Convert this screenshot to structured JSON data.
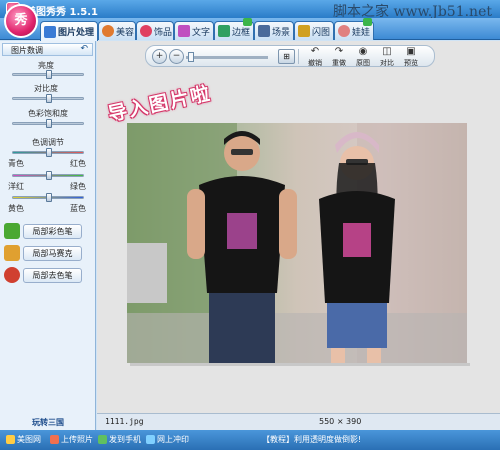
{
  "window": {
    "title": "美图秀秀 1.5.1",
    "watermark": "脚本之家 www.Jb51.net",
    "logo_text": "秀"
  },
  "tabs": [
    {
      "label": "图片处理",
      "icon": "image-edit-icon",
      "color": "#3a7bd5",
      "active": true
    },
    {
      "label": "美容",
      "icon": "face-icon",
      "color": "#e07a30",
      "active": false
    },
    {
      "label": "饰品",
      "icon": "heart-icon",
      "color": "#e04060",
      "active": false
    },
    {
      "label": "文字",
      "icon": "text-icon",
      "color": "#c050c0",
      "active": false
    },
    {
      "label": "边框",
      "icon": "frame-icon",
      "color": "#30a060",
      "active": false,
      "new": true
    },
    {
      "label": "场景",
      "icon": "scene-icon",
      "color": "#4a6a9a",
      "active": false
    },
    {
      "label": "闪图",
      "icon": "flash-icon",
      "color": "#d0a020",
      "active": false
    },
    {
      "label": "娃娃",
      "icon": "doll-icon",
      "color": "#e08080",
      "active": false,
      "new": true
    }
  ],
  "left_panel": {
    "header": "图片数调",
    "back_symbol": "↶",
    "sliders": [
      {
        "label": "亮度",
        "value": 0.5
      },
      {
        "label": "对比度",
        "value": 0.5
      },
      {
        "label": "色彩饱和度",
        "value": 0.5
      }
    ],
    "color_section_label": "色调调节",
    "color_sliders": [
      {
        "left": "青色",
        "right": "红色",
        "value": 0.5
      },
      {
        "left": "洋红",
        "right": "绿色",
        "value": 0.5
      },
      {
        "left": "黄色",
        "right": "蓝色",
        "value": 0.5
      }
    ],
    "tools": [
      {
        "label": "局部彩色笔",
        "icon": "color-brush-icon",
        "color": "#4aa832"
      },
      {
        "label": "局部马赛克",
        "icon": "mosaic-icon",
        "color": "#e0a030"
      },
      {
        "label": "局部去色笔",
        "icon": "decolor-brush-icon",
        "color": "#d04030"
      }
    ],
    "bottom_link": "玩转三国"
  },
  "toolbar": {
    "zoom_in": "+",
    "zoom_out": "−",
    "fit": "⊞",
    "actions": [
      {
        "label": "撤销",
        "icon": "undo-icon",
        "glyph": "↶"
      },
      {
        "label": "重做",
        "icon": "redo-icon",
        "glyph": "↷"
      },
      {
        "label": "原图",
        "icon": "original-icon",
        "glyph": "◉"
      },
      {
        "label": "对比",
        "icon": "compare-icon",
        "glyph": "◫"
      },
      {
        "label": "预览",
        "icon": "preview-icon",
        "glyph": "▣"
      }
    ]
  },
  "canvas": {
    "promo_text": "导入图片啦"
  },
  "status": {
    "filename": "1111.jpg",
    "dimensions": "550 × 390"
  },
  "footer": {
    "links": [
      {
        "label": "美图网",
        "icon": "meitu-web-icon",
        "color": "#ffcc44"
      },
      {
        "label": "上传照片",
        "icon": "upload-icon",
        "color": "#f07050"
      },
      {
        "label": "发到手机",
        "icon": "phone-icon",
        "color": "#60c060"
      },
      {
        "label": "网上冲印",
        "icon": "print-icon",
        "color": "#80d0ff"
      }
    ],
    "tip": "【教程】利用透明度做倒影!"
  }
}
